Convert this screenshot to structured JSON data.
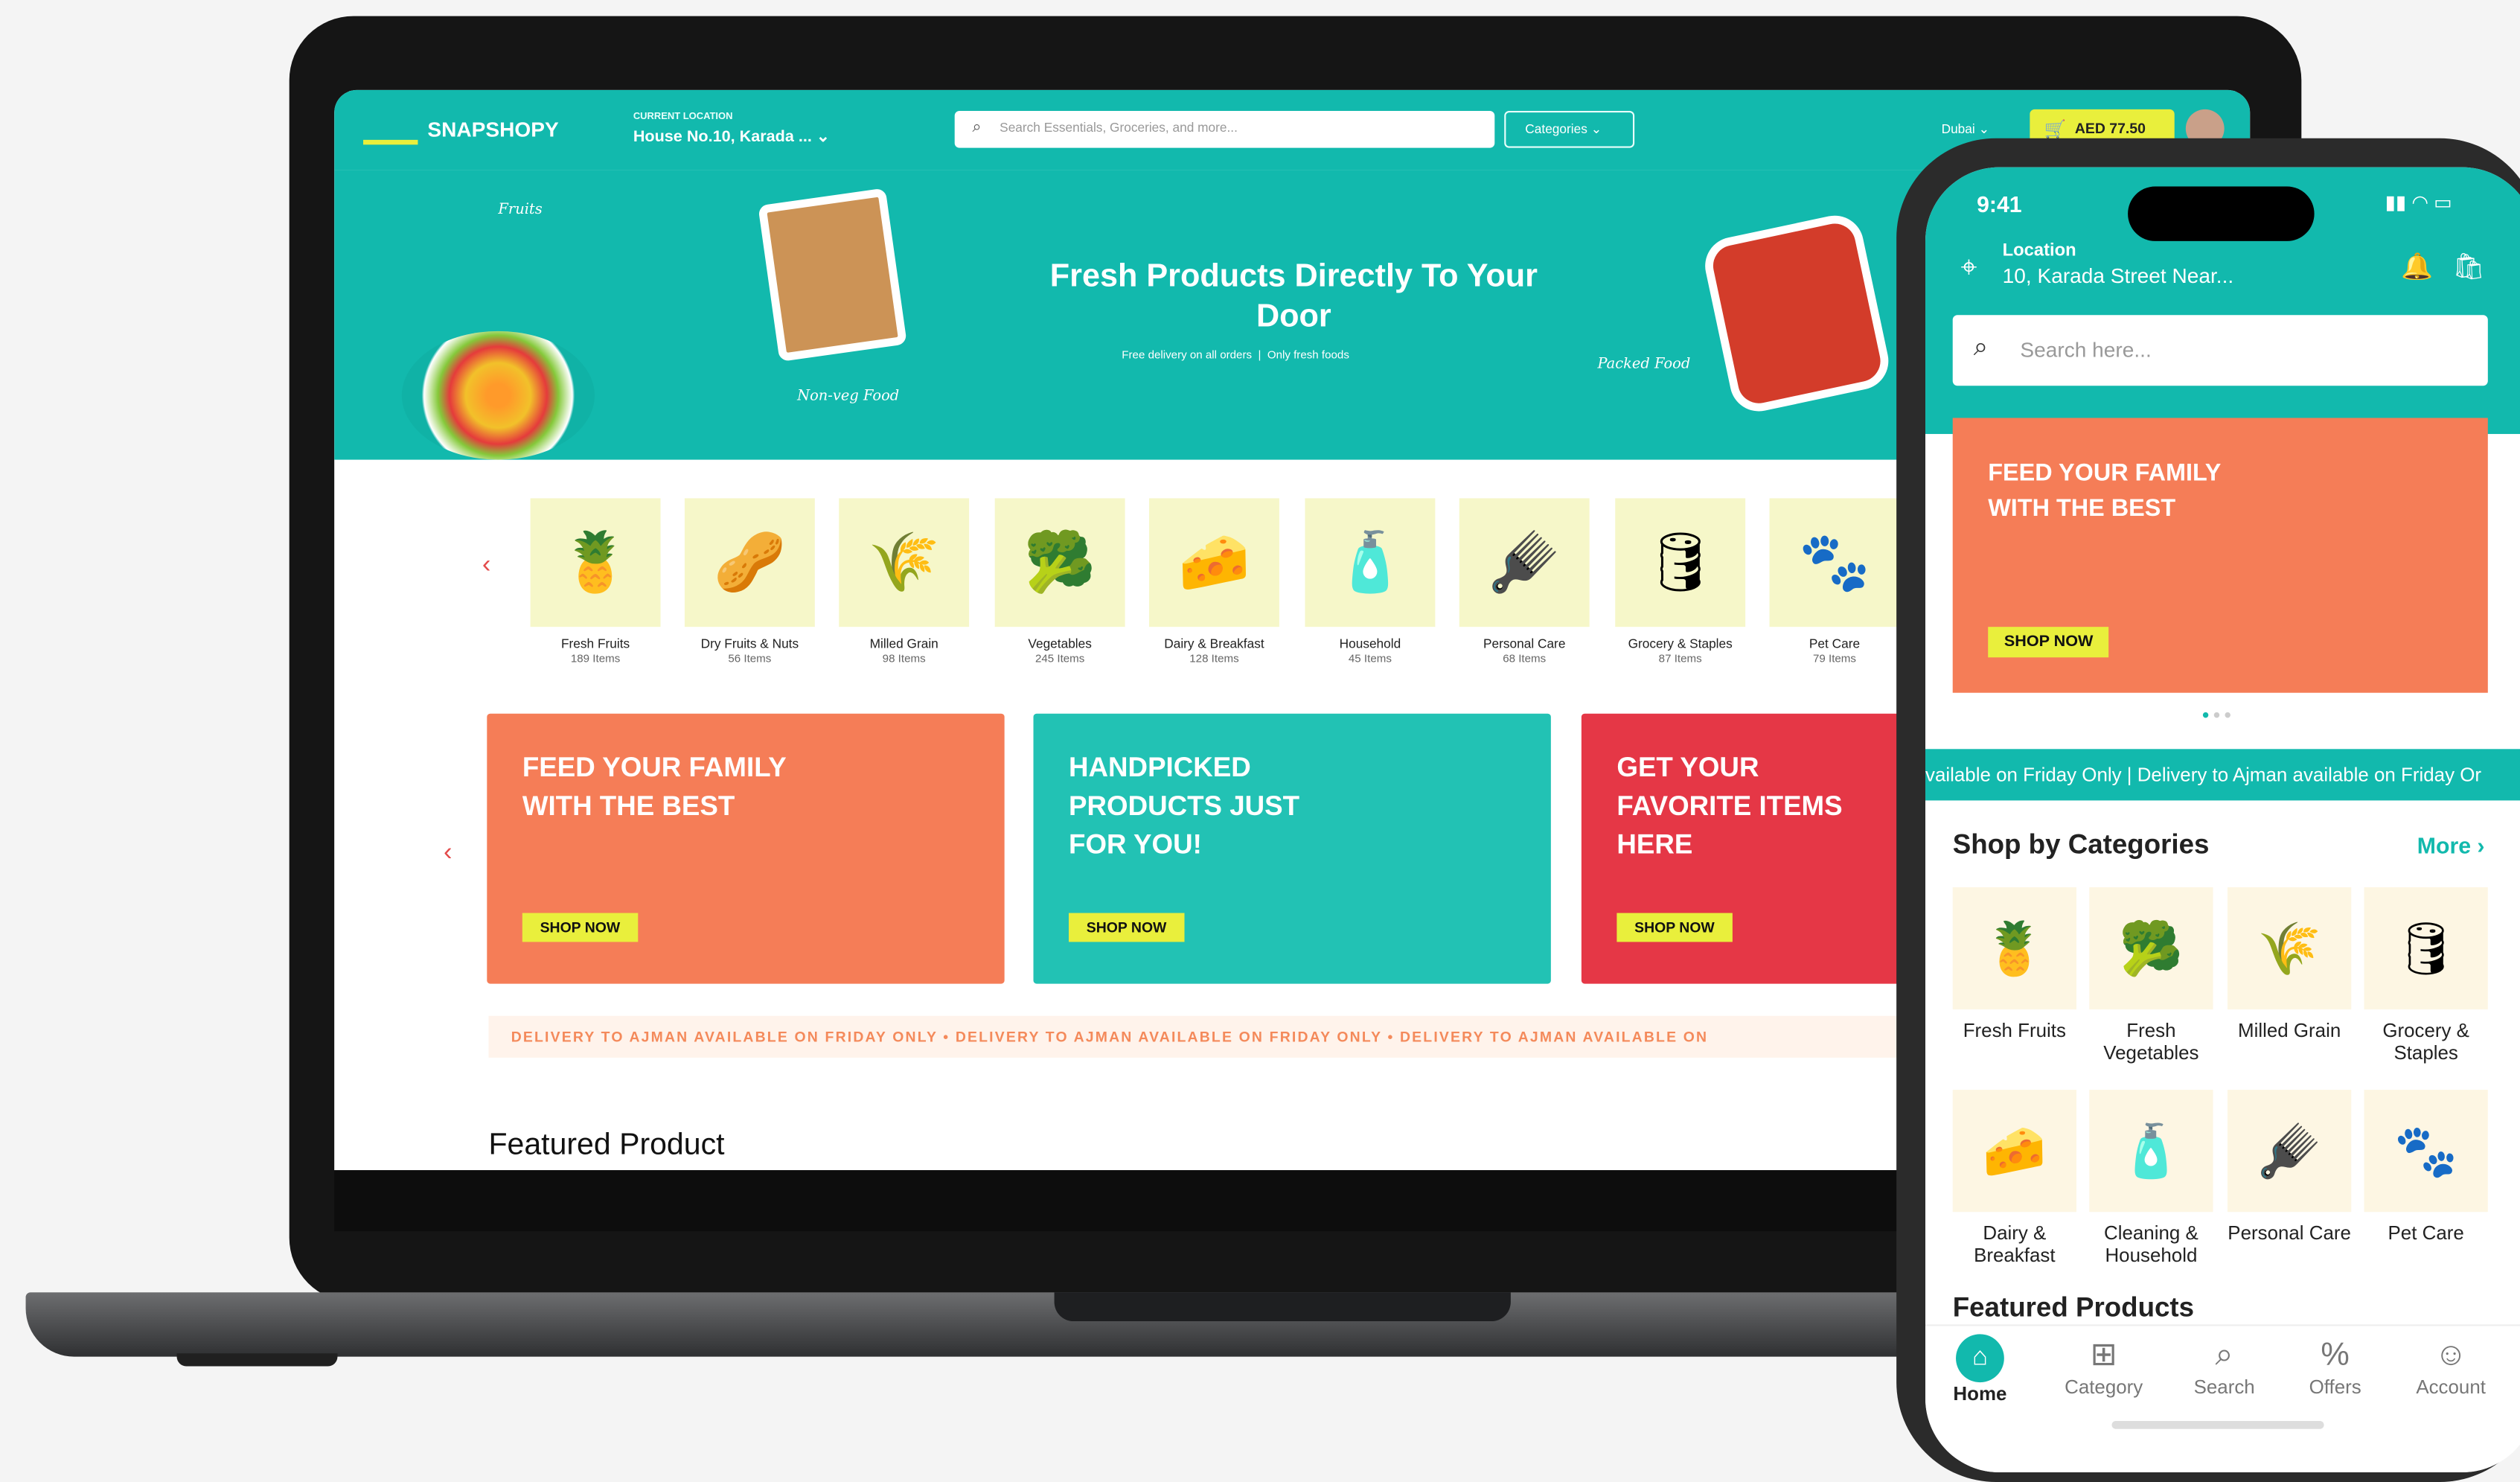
{
  "web": {
    "logo": "SNAPSHOPY",
    "location_label": "CURRENT LOCATION",
    "location_value": "House No.10, Karada ...",
    "search_placeholder": "Search Essentials, Groceries, and more...",
    "categories_button": "Categories",
    "city": "Dubai",
    "cart_total": "AED 77.50",
    "hero_title": "Fresh Products Directly To Your Door",
    "hero_badges": [
      "Free delivery on all orders",
      "Only fresh foods"
    ],
    "hero_tags": [
      "Fruits",
      "Non-veg Food",
      "Packed Food"
    ],
    "categories": [
      {
        "name": "Fresh Fruits",
        "count": "189 Items"
      },
      {
        "name": "Dry Fruits & Nuts",
        "count": "56 Items"
      },
      {
        "name": "Milled Grain",
        "count": "98 Items"
      },
      {
        "name": "Vegetables",
        "count": "245 Items"
      },
      {
        "name": "Dairy & Breakfast",
        "count": "128 Items"
      },
      {
        "name": "Household",
        "count": "45 Items"
      },
      {
        "name": "Personal Care",
        "count": "68 Items"
      },
      {
        "name": "Grocery & Staples",
        "count": "87 Items"
      },
      {
        "name": "Pet Care",
        "count": "79 Items"
      }
    ],
    "banners": [
      {
        "title": "FEED YOUR FAMILY WITH THE BEST",
        "cta": "SHOP NOW",
        "color": "#f57d57"
      },
      {
        "title": "HANDPICKED PRODUCTS JUST FOR YOU!",
        "cta": "SHOP NOW",
        "color": "#22c2b4"
      },
      {
        "title": "GET YOUR FAVORITE ITEMS HERE",
        "cta": "SHOP NOW",
        "color": "#e53746"
      }
    ],
    "ticker": "DELIVERY TO AJMAN AVAILABLE ON FRIDAY ONLY   •   DELIVERY TO AJMAN AVAILABLE ON FRIDAY ONLY   •   DELIVERY TO AJMAN AVAILABLE ON",
    "featured_title": "Featured Product"
  },
  "phone": {
    "time": "9:41",
    "location_label": "Location",
    "location_value": "10, Karada Street Near...",
    "search_placeholder": "Search here...",
    "banner_title": "FEED YOUR FAMILY WITH THE BEST",
    "banner_cta": "SHOP NOW",
    "ticker": "vailable on Friday Only  |  Delivery to Ajman available on Friday Or",
    "section_title": "Shop by Categories",
    "more": "More",
    "categories": [
      "Fresh Fruits",
      "Fresh Vegetables",
      "Milled Grain",
      "Grocery & Staples",
      "Dairy & Breakfast",
      "Cleaning & Household",
      "Personal Care",
      "Pet Care"
    ],
    "featured_title": "Featured Products",
    "nav": [
      "Home",
      "Category",
      "Search",
      "Offers",
      "Account"
    ]
  },
  "colors": {
    "teal": "#12b9ad",
    "yellow": "#e9ef3c",
    "orange": "#f57d57",
    "red": "#e53746"
  }
}
